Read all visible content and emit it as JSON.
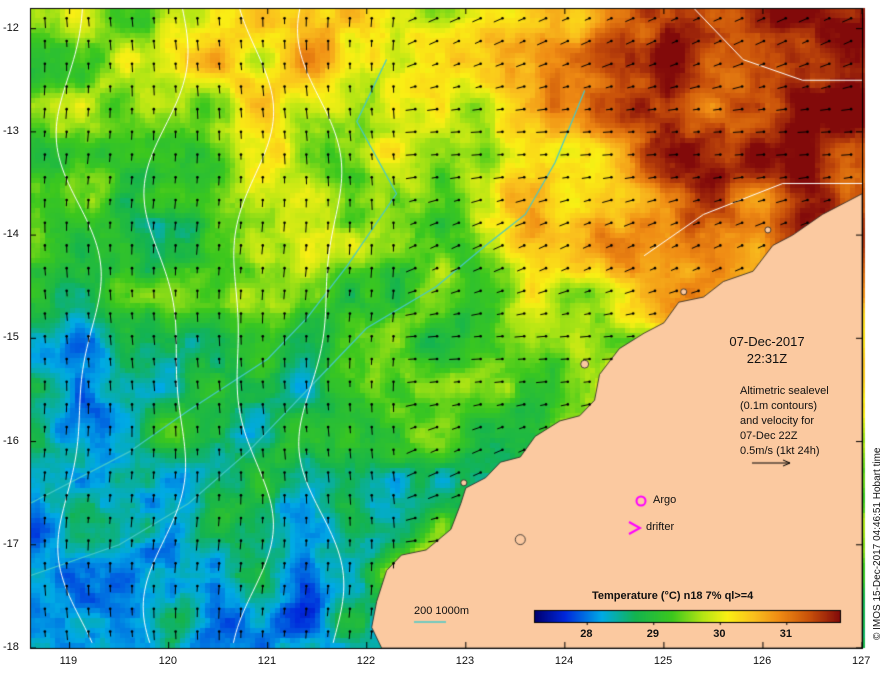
{
  "map": {
    "x_ticks": [
      "119",
      "120",
      "121",
      "122",
      "123",
      "124",
      "125",
      "126",
      "127"
    ],
    "y_ticks": [
      "-12",
      "-13",
      "-14",
      "-15",
      "-16",
      "-17",
      "-18"
    ],
    "extent": {
      "lon_min": 118.6,
      "lon_max": 127.0,
      "lat_min": -18.0,
      "lat_max": -11.8
    },
    "colors": {
      "land": "#fbc9a0",
      "contour": "#ffffff",
      "isobath": "#46c8c8",
      "vector": "#000000",
      "marker": "#ff00ff"
    }
  },
  "annotation": {
    "date": "07-Dec-2017",
    "time": "22:31Z",
    "alt_lines": [
      "Altimetric sealevel",
      "(0.1m contours)",
      "and velocity for",
      "07-Dec 22Z",
      "0.5m/s (1kt 24h)"
    ]
  },
  "legend": {
    "title": "Temperature (°C) n18 7% ql>=4",
    "ticks": [
      "28",
      "29",
      "30",
      "31"
    ],
    "range": [
      27.2,
      31.8
    ],
    "depth_label": "200  1000m",
    "argo": "Argo",
    "drifter": "drifter"
  },
  "credit": "© IMOS 15-Dec-2017 04:46:51 Hobart time",
  "icons": {
    "argo": "circle-marker-icon",
    "drifter": "chevron-marker-icon",
    "scale": "arrow-icon"
  }
}
